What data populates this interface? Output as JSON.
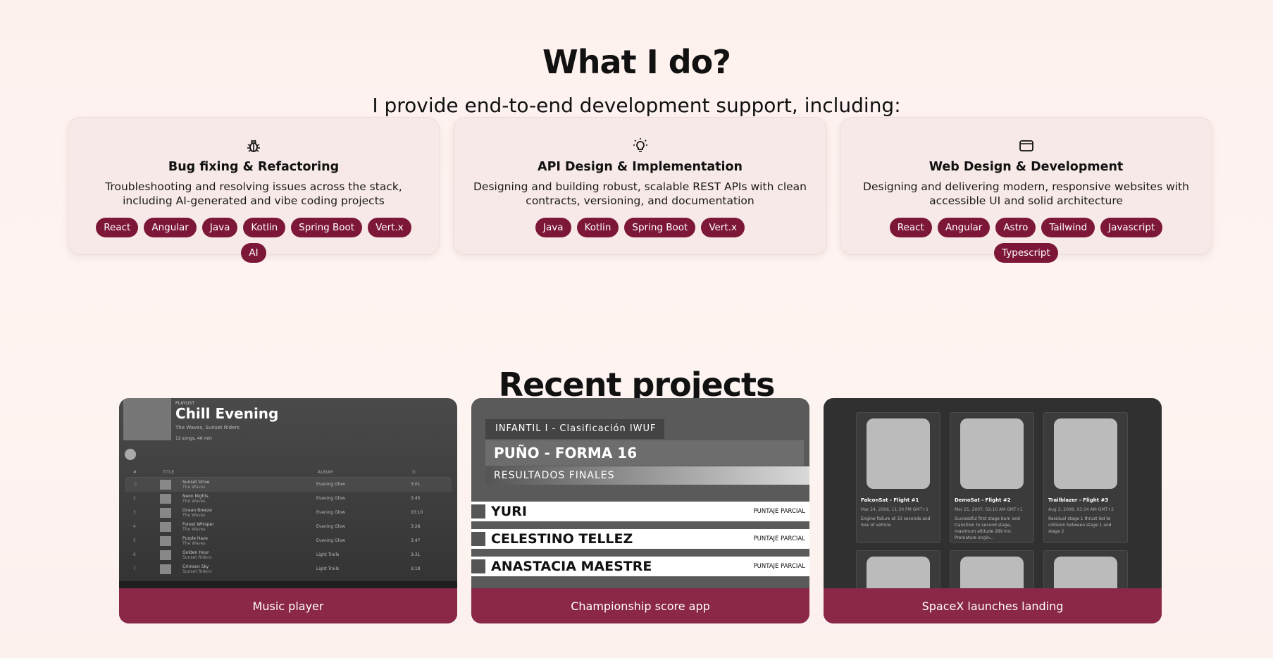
{
  "what_i_do": {
    "title": "What I do?",
    "subtitle": "I provide end-to-end development support, including:",
    "services": [
      {
        "icon": "bug-icon",
        "title": "Bug fixing & Refactoring",
        "description": "Troubleshooting and resolving issues across the stack, including AI-generated and vibe coding projects",
        "tags": [
          "React",
          "Angular",
          "Java",
          "Kotlin",
          "Spring Boot",
          "Vert.x",
          "AI"
        ]
      },
      {
        "icon": "lightbulb-icon",
        "title": "API Design & Implementation",
        "description": "Designing and building robust, scalable REST APIs with clean contracts, versioning, and documentation",
        "tags": [
          "Java",
          "Kotlin",
          "Spring Boot",
          "Vert.x"
        ]
      },
      {
        "icon": "browser-window-icon",
        "title": "Web Design & Development",
        "description": "Designing and delivering modern, responsive websites with accessible UI and solid architecture",
        "tags": [
          "React",
          "Angular",
          "Astro",
          "Tailwind",
          "Javascript",
          "Typescript"
        ]
      }
    ]
  },
  "projects": {
    "title": "Recent projects",
    "items": [
      {
        "label": "Music player",
        "preview": {
          "kind": "PLAYLIST",
          "name": "Chill Evening",
          "artist": "The Waves, Sunset Riders",
          "length": "12 songs, 46 min",
          "columns": [
            "#",
            "TITLE",
            "ALBUM",
            "⏱"
          ],
          "rows": [
            {
              "no": "♫",
              "title": "Sunset Drive",
              "artist": "The Waves",
              "album": "Evening Glow",
              "dur": "3:01"
            },
            {
              "no": "2",
              "title": "Neon Nights",
              "artist": "The Waves",
              "album": "Evening Glow",
              "dur": "3:45"
            },
            {
              "no": "3",
              "title": "Ocean Breeze",
              "artist": "The Waves",
              "album": "Evening Glow",
              "dur": "03:10"
            },
            {
              "no": "4",
              "title": "Forest Whisper",
              "artist": "The Waves",
              "album": "Evening Glow",
              "dur": "3:28"
            },
            {
              "no": "5",
              "title": "Purple Haze",
              "artist": "The Waves",
              "album": "Evening Glow",
              "dur": "3:47"
            },
            {
              "no": "6",
              "title": "Golden Hour",
              "artist": "Sunset Riders",
              "album": "Light Trails",
              "dur": "3:31"
            },
            {
              "no": "7",
              "title": "Crimson Sky",
              "artist": "Sunset Riders",
              "album": "Light Trails",
              "dur": "3:18"
            }
          ]
        }
      },
      {
        "label": "Championship score app",
        "preview": {
          "category": "INFANTIL I - Clasificación IWUF",
          "event": "PUÑO - FORMA 16",
          "stage": "RESULTADOS FINALES",
          "rows": [
            {
              "name": "YURI",
              "score_label": "PUNTAJE PARCIAL"
            },
            {
              "name": "CELESTINO TELLEZ",
              "score_label": "PUNTAJE PARCIAL"
            },
            {
              "name": "ANASTACIA MAESTRE",
              "score_label": "PUNTAJE PARCIAL"
            }
          ]
        }
      },
      {
        "label": "SpaceX launches landing",
        "preview": {
          "cards": [
            {
              "name": "FalconSat - Flight #1",
              "date": "Mar 24, 2006, 11:30 PM GMT+1",
              "desc": "Engine failure at 33 seconds and loss of vehicle"
            },
            {
              "name": "DemoSat - Flight #2",
              "date": "Mar 21, 2007, 02:10 AM GMT+1",
              "desc": "Successful first stage burn and transition to second stage, maximum altitude 289 km. Premature engin..."
            },
            {
              "name": "Trailblazer - Flight #3",
              "date": "Aug 3, 2008, 03:34 AM GMT+2",
              "desc": "Residual stage 1 thrust led to collision between stage 1 and stage 2"
            }
          ]
        }
      }
    ]
  },
  "colors": {
    "accent": "#7d1738",
    "bar": "#8b2848",
    "background": "#fdf2ef"
  }
}
